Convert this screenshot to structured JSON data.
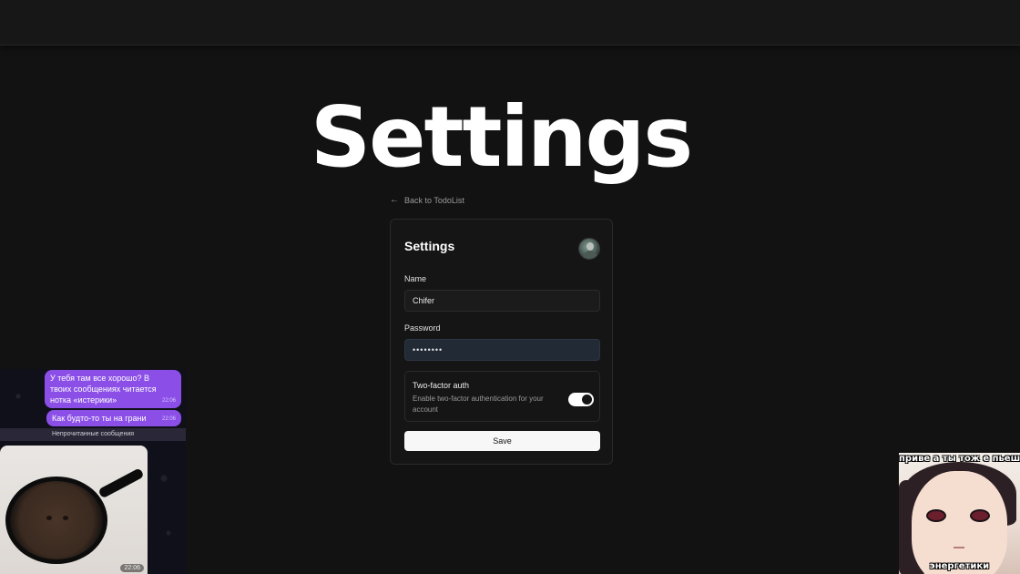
{
  "page": {
    "heading": "Settings",
    "back_link": "Back to TodoList"
  },
  "settings_card": {
    "title": "Settings",
    "name_label": "Name",
    "name_value": "Chifer",
    "password_label": "Password",
    "password_value": "••••••••",
    "two_factor": {
      "title": "Two-factor auth",
      "description": "Enable two-factor authentication for your account",
      "enabled": true
    },
    "save_label": "Save"
  },
  "chat_overlay": {
    "messages": [
      {
        "text": "У тебя там все хорошо? В твоих сообщениях читается нотка «истерики»",
        "time": "22:06"
      },
      {
        "text": "Как будто-то ты на грани",
        "time": "22:06"
      }
    ],
    "unread_label": "Непрочитанные сообщения",
    "photo_time": "22:06"
  },
  "meme_overlay": {
    "top_caption": "приве а ты тож е пьеш",
    "bottom_caption": "энергетики"
  },
  "colors": {
    "background": "#121212",
    "card": "#151515",
    "accent_purple": "#8b4fe8",
    "password_field": "#222a36"
  }
}
